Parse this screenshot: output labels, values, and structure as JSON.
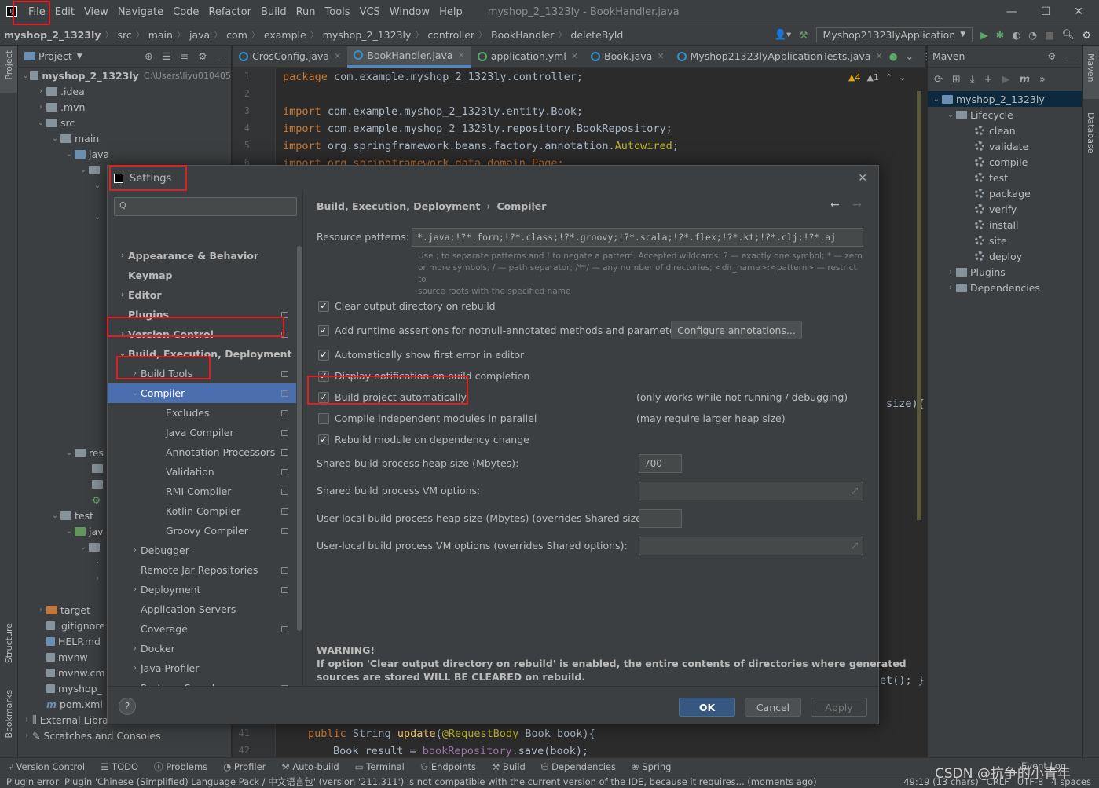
{
  "menu": [
    "File",
    "Edit",
    "View",
    "Navigate",
    "Code",
    "Refactor",
    "Build",
    "Run",
    "Tools",
    "VCS",
    "Window",
    "Help"
  ],
  "window_title": "myshop_2_1323ly - BookHandler.java",
  "breadcrumb": [
    "myshop_2_1323ly",
    "src",
    "main",
    "java",
    "com",
    "example",
    "myshop_2_1323ly",
    "controller",
    "BookHandler",
    "deleteById"
  ],
  "run_config": "Myshop21323lyApplication",
  "project_panel": {
    "title": "Project",
    "root_label": "myshop_2_1323ly",
    "root_path": "C:\\Users\\liyu010405",
    "items": [
      ".idea",
      ".mvn",
      "src",
      "main",
      "java",
      "res",
      "test",
      "jav",
      "target",
      ".gitignore",
      "HELP.md",
      "mvnw",
      "mvnw.cm",
      "myshop_",
      "pom.xml",
      "External Libraries",
      "Scratches and Consoles"
    ]
  },
  "editor_tabs": [
    "CrosConfig.java",
    "BookHandler.java",
    "application.yml",
    "Book.java",
    "Myshop21323lyApplicationTests.java"
  ],
  "inspections": {
    "warnings": "4",
    "weak": "1"
  },
  "code_lines": {
    "l1_kw": "package ",
    "l1": "com.example.myshop_2_1323ly.controller;",
    "l3_kw": "import ",
    "l3": "com.example.myshop_2_1323ly.entity.Book;",
    "l4_kw": "import ",
    "l4": "com.example.myshop_2_1323ly.repository.BookRepository;",
    "l5_kw": "import ",
    "l5a": "org.springframework.beans.factory.annotation.",
    "l5b": "Autowired",
    "l5c": ";",
    "l6": "import org.springframework.data.domain.Page;",
    "frag_size": "size){",
    "frag_et": "et(); }",
    "l41_kw": "public ",
    "l41a": "String ",
    "l41fn": "update",
    "l41b": "(",
    "l41an": "@RequestBody",
    "l41c": " Book book){",
    "l42a": "Book result = ",
    "l42f": "bookRepository",
    "l42b": ".save(book);"
  },
  "line_numbers": [
    "1",
    "2",
    "3",
    "4",
    "5",
    "6",
    "41",
    "42"
  ],
  "maven": {
    "title": "Maven",
    "project": "myshop_2_1323ly",
    "lifecycle_label": "Lifecycle",
    "lifecycle": [
      "clean",
      "validate",
      "compile",
      "test",
      "package",
      "verify",
      "install",
      "site",
      "deploy"
    ],
    "plugins": "Plugins",
    "dependencies": "Dependencies"
  },
  "left_stripe": {
    "project": "Project",
    "structure": "Structure",
    "bookmarks": "Bookmarks"
  },
  "right_stripe": {
    "maven": "Maven",
    "database": "Database"
  },
  "tool_windows": [
    "Version Control",
    "TODO",
    "Problems",
    "Profiler",
    "Auto-build",
    "Terminal",
    "Endpoints",
    "Build",
    "Dependencies",
    "Spring"
  ],
  "status": {
    "message": "Plugin error: Plugin 'Chinese (Simplified) Language Pack / 中文语言包' (version '211.311') is not compatible with the current version of the IDE, because it requires... (moments ago)",
    "position": "49:19 (13 chars)",
    "line_sep": "CRLF",
    "encoding": "UTF-8",
    "indent": "4 spaces",
    "event_log": "Event Log",
    "watermark": "CSDN @抗争的小青年"
  },
  "settings": {
    "title": "Settings",
    "search_placeholder": "Q",
    "tree": [
      {
        "label": "Appearance & Behavior",
        "bold": true,
        "arrow": "›",
        "indent": 0
      },
      {
        "label": "Keymap",
        "bold": true,
        "arrow": "",
        "indent": 0
      },
      {
        "label": "Editor",
        "bold": true,
        "arrow": "›",
        "indent": 0
      },
      {
        "label": "Plugins",
        "bold": true,
        "arrow": "",
        "indent": 0
      },
      {
        "label": "Version Control",
        "bold": true,
        "arrow": "›",
        "indent": 0
      },
      {
        "label": "Build, Execution, Deployment",
        "bold": true,
        "arrow": "⌄",
        "indent": 0
      },
      {
        "label": "Build Tools",
        "arrow": "›",
        "indent": 1
      },
      {
        "label": "Compiler",
        "arrow": "⌄",
        "indent": 1
      },
      {
        "label": "Excludes",
        "arrow": "",
        "indent": 2
      },
      {
        "label": "Java Compiler",
        "arrow": "",
        "indent": 2
      },
      {
        "label": "Annotation Processors",
        "arrow": "",
        "indent": 2
      },
      {
        "label": "Validation",
        "arrow": "",
        "indent": 2
      },
      {
        "label": "RMI Compiler",
        "arrow": "",
        "indent": 2
      },
      {
        "label": "Kotlin Compiler",
        "arrow": "",
        "indent": 2
      },
      {
        "label": "Groovy Compiler",
        "arrow": "",
        "indent": 2
      },
      {
        "label": "Debugger",
        "arrow": "›",
        "indent": 1
      },
      {
        "label": "Remote Jar Repositories",
        "arrow": "",
        "indent": 1
      },
      {
        "label": "Deployment",
        "arrow": "›",
        "indent": 1
      },
      {
        "label": "Application Servers",
        "arrow": "",
        "indent": 1
      },
      {
        "label": "Coverage",
        "arrow": "",
        "indent": 1
      },
      {
        "label": "Docker",
        "arrow": "›",
        "indent": 1
      },
      {
        "label": "Java Profiler",
        "arrow": "›",
        "indent": 1
      },
      {
        "label": "Package Search",
        "arrow": "",
        "indent": 1
      },
      {
        "label": "Required Plugins",
        "arrow": "",
        "indent": 1
      }
    ],
    "selected": "Compiler",
    "crumb1": "Build, Execution, Deployment",
    "crumb2": "Compiler",
    "resource_label": "Resource patterns:",
    "resource_value": "*.java;!?*.form;!?*.class;!?*.groovy;!?*.scala;!?*.flex;!?*.kt;!?*.clj;!?*.aj",
    "resource_hint_1": "Use ; to separate patterns and ! to negate a pattern. Accepted wildcards: ? — exactly one symbol; * — zero",
    "resource_hint_2": "or more symbols; / — path separator; /**/ — any number of directories; <dir_name>:<pattern> — restrict to",
    "resource_hint_3": "source roots with the specified name",
    "opt_clear": "Clear output directory on rebuild",
    "opt_assert": "Add runtime assertions for notnull-annotated methods and parameters",
    "configure_btn": "Configure annotations...",
    "opt_first_error": "Automatically show first error in editor",
    "opt_notification": "Display notification on build completion",
    "opt_auto_build": "Build project automatically",
    "opt_auto_note": "(only works while not running / debugging)",
    "opt_parallel": "Compile independent modules in parallel",
    "opt_parallel_note": "(may require larger heap size)",
    "opt_rebuild": "Rebuild module on dependency change",
    "heap_label": "Shared build process heap size (Mbytes):",
    "heap_value": "700",
    "vm_label": "Shared build process VM options:",
    "user_heap_label": "User-local build process heap size (Mbytes) (overrides Shared size):",
    "user_vm_label": "User-local build process VM options (overrides Shared options):",
    "warning_title": "WARNING!",
    "warning_1": "If option 'Clear output directory on rebuild' is enabled, the entire contents of directories where generated",
    "warning_2": "sources are stored WILL BE CLEARED on rebuild.",
    "ok": "OK",
    "cancel": "Cancel",
    "apply": "Apply",
    "help": "?"
  },
  "colors": {
    "accent": "#4b6eaf",
    "highlight": "#e02020",
    "ok_button": "#365880"
  }
}
